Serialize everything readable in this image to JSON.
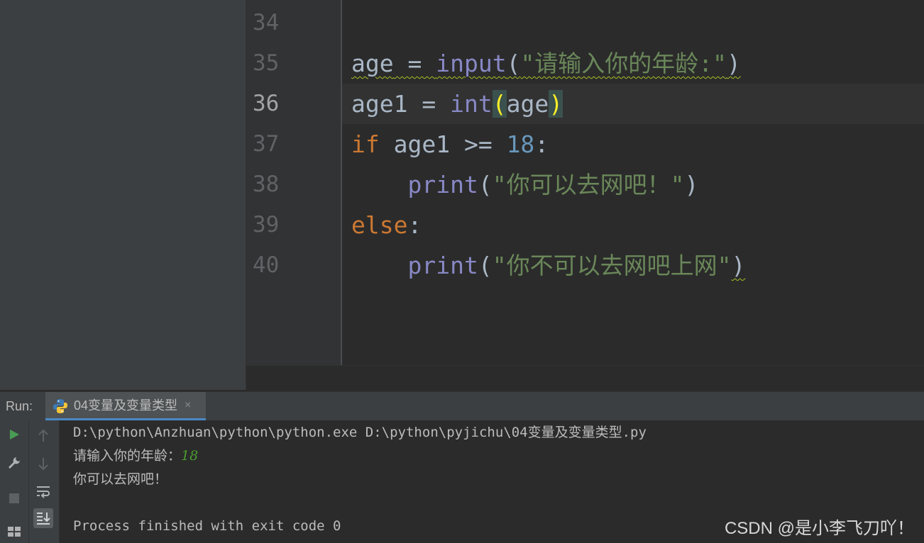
{
  "editor": {
    "lines": [
      {
        "num": "34"
      },
      {
        "num": "35",
        "tokens": {
          "a": "age",
          "b": " = ",
          "c": "input",
          "d": "(",
          "e": "\"请输入你的年龄:\"",
          "f": ")"
        }
      },
      {
        "num": "36",
        "tokens": {
          "a": "age1",
          "b": " = ",
          "c": "int",
          "d": "(",
          "e": "age",
          "f": ")"
        }
      },
      {
        "num": "37",
        "tokens": {
          "a": "if",
          "b": " age1 >= ",
          "c": "18",
          "d": ":"
        }
      },
      {
        "num": "38",
        "tokens": {
          "a": "    ",
          "b": "print",
          "c": "(",
          "d": "\"你可以去网吧！\"",
          "e": ")"
        }
      },
      {
        "num": "39",
        "tokens": {
          "a": "else",
          "b": ":"
        }
      },
      {
        "num": "40",
        "tokens": {
          "a": "    ",
          "b": "print",
          "c": "(",
          "d": "\"你不可以去网吧上网\"",
          "e": ")"
        }
      }
    ],
    "current_line": "36"
  },
  "run": {
    "label": "Run:",
    "tab_label": "04变量及变量类型",
    "tab_close": "×",
    "console": {
      "command": "D:\\python\\Anzhuan\\python\\python.exe D:\\python\\pyjichu\\04变量及变量类型.py",
      "prompt": "请输入你的年龄：",
      "input_value": "18",
      "output": "你可以去网吧！",
      "exit": "Process finished with exit code 0"
    }
  },
  "toolbar": {
    "rerun_icon": "play-icon",
    "settings_icon": "wrench-icon",
    "stop_icon": "stop-icon",
    "layout_icon": "layout-icon",
    "up_icon": "arrow-up-icon",
    "down_icon": "arrow-down-icon",
    "wrap_icon": "soft-wrap-icon",
    "scroll_icon": "scroll-to-end-icon"
  },
  "watermark": "CSDN @是小李飞刀吖！",
  "colors": {
    "keyword": "#cc7832",
    "builtin": "#8888c6",
    "number": "#6897bb",
    "string": "#6a8759",
    "run_green": "#499c54"
  }
}
